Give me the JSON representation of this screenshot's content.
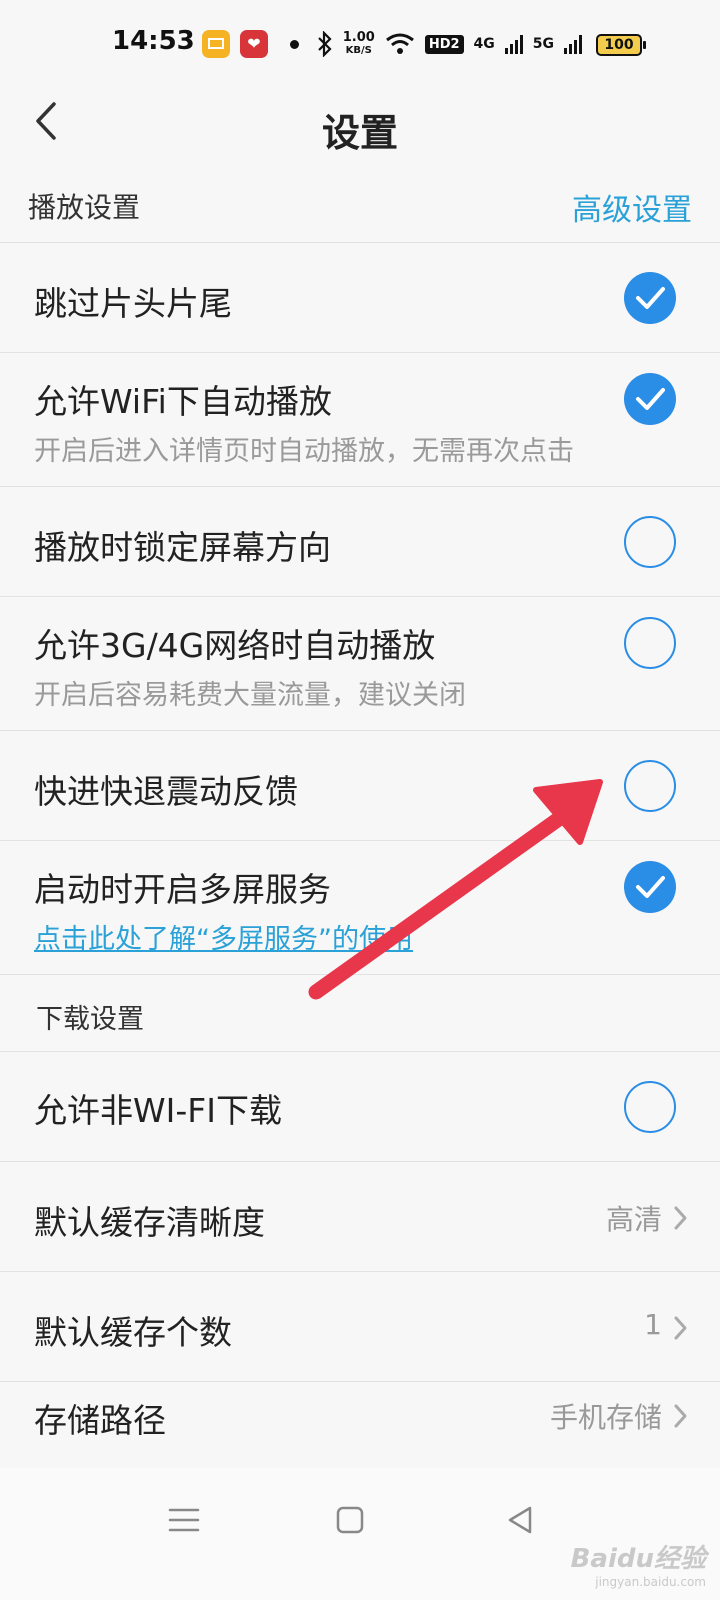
{
  "status_bar": {
    "time": "14:53",
    "speed_value": "1.00",
    "speed_unit": "KB/S",
    "hd_label": "HD2",
    "net_4g": "4G",
    "net_5g": "5G",
    "battery": "100"
  },
  "header": {
    "title": "设置"
  },
  "play_section": {
    "title": "播放设置",
    "advanced_link": "高级设置"
  },
  "play_rows": [
    {
      "label": "跳过片头片尾",
      "checked": true
    },
    {
      "label": "允许WiFi下自动播放",
      "sub": "开启后进入详情页时自动播放，无需再次点击",
      "checked": true
    },
    {
      "label": "播放时锁定屏幕方向",
      "checked": false
    },
    {
      "label": "允许3G/4G网络时自动播放",
      "sub": "开启后容易耗费大量流量，建议关闭",
      "checked": false
    },
    {
      "label": "快进快退震动反馈",
      "checked": false
    },
    {
      "label": "启动时开启多屏服务",
      "link": "点击此处了解“多屏服务”的使用",
      "checked": true
    }
  ],
  "download_section": {
    "title": "下载设置"
  },
  "download_rows": [
    {
      "label": "允许非WI-FI下载",
      "checked": false
    },
    {
      "label": "默认缓存清晰度",
      "value": "高清"
    },
    {
      "label": "默认缓存个数",
      "value": "1"
    },
    {
      "label": "存储路径",
      "value": "手机存储"
    }
  ],
  "watermark": {
    "main": "Baidu经验",
    "sub": "jingyan.baidu.com"
  },
  "colors": {
    "accent": "#2a8de6",
    "link": "#2aa1d7",
    "arrow": "#e8364a"
  }
}
